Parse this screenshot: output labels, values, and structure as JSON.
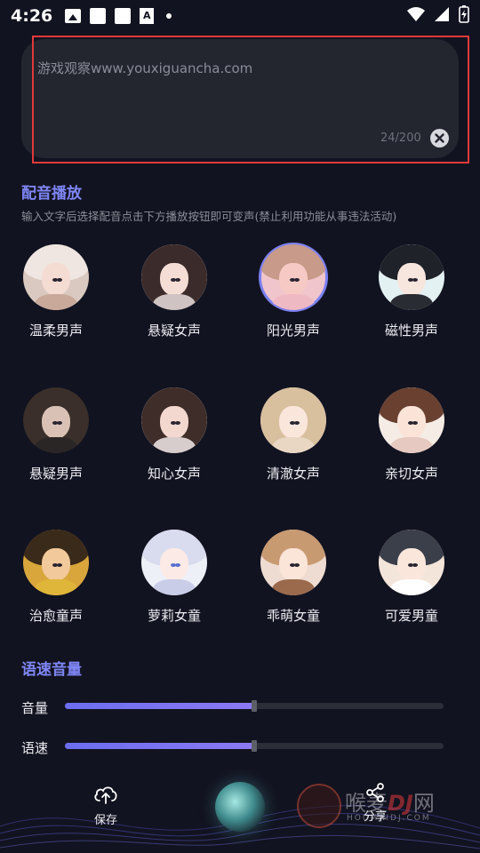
{
  "status_bar": {
    "time": "4:26",
    "icons": [
      "image-icon",
      "sim-card-icon",
      "sim-card-icon",
      "font-icon",
      "dot-icon",
      "wifi-icon",
      "signal-icon",
      "battery-charging-icon"
    ]
  },
  "text_input": {
    "value": "游戏观察www.youxiguancha.com",
    "char_count": "24/200"
  },
  "dubbing": {
    "title": "配音播放",
    "hint": "输入文字后选择配音点击下方播放按钮即可变声(禁止利用功能从事违法活动)",
    "voices": [
      {
        "label": "温柔男声",
        "selected": false
      },
      {
        "label": "悬疑女声",
        "selected": false
      },
      {
        "label": "阳光男声",
        "selected": true
      },
      {
        "label": "磁性男声",
        "selected": false
      },
      {
        "label": "悬疑男声",
        "selected": false
      },
      {
        "label": "知心女声",
        "selected": false
      },
      {
        "label": "清澈女声",
        "selected": false
      },
      {
        "label": "亲切女声",
        "selected": false
      },
      {
        "label": "治愈童声",
        "selected": false
      },
      {
        "label": "萝莉女童",
        "selected": false
      },
      {
        "label": "乖萌女童",
        "selected": false
      },
      {
        "label": "可爱男童",
        "selected": false
      }
    ]
  },
  "speed_volume": {
    "title": "语速音量",
    "volume_label": "音量",
    "volume_value": 0.5,
    "speed_label": "语速",
    "speed_value": 0.5
  },
  "bottom": {
    "save_label": "保存",
    "share_label": "分享",
    "watermark_text": "喉麦",
    "watermark_brand": "DJ",
    "watermark_suffix": "网",
    "watermark_domain": "HOUMAIDJ.COM"
  },
  "colors": {
    "accent": "#7f86f5",
    "highlight_border": "#e0393b",
    "background": "#121320"
  }
}
